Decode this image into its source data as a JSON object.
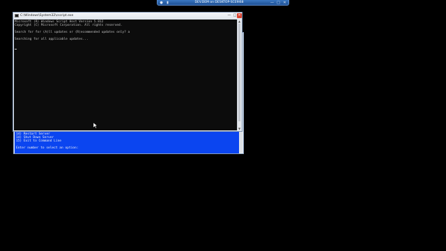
{
  "remote_bar": {
    "title": "DEV.DEM on DESKTOP-SCE9I68"
  },
  "back_window": {
    "menu_lines": [
      "14) Restart Server",
      "14) Shut Down Server",
      "15) Exit to Command Line",
      "",
      "Enter number to select an option:"
    ]
  },
  "front_window": {
    "title": "C:\\Windows\\System32\\cscript.exe",
    "console_lines": [
      "Microsoft (R) Windows Script Host Version 5.812",
      "Copyright (C) Microsoft Corporation. All rights reserved.",
      "",
      "Search for for (A)ll updates or (R)ecommended updates only? a",
      "",
      "Searching for all applicable updates..."
    ]
  },
  "icons": {
    "pin": "pin-icon",
    "signal": "signal-icon",
    "minimize": "minimize-icon",
    "restore": "restore-icon",
    "close": "close-icon"
  }
}
